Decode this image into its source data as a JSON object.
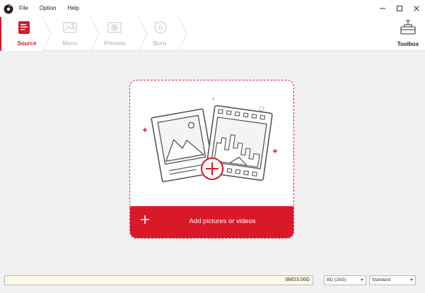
{
  "menu": {
    "items": [
      "File",
      "Option",
      "Help"
    ]
  },
  "steps": [
    {
      "label": "Source",
      "icon": "source-icon",
      "active": true
    },
    {
      "label": "Menu",
      "icon": "menu-icon",
      "active": false
    },
    {
      "label": "Preview",
      "icon": "preview-icon",
      "active": false
    },
    {
      "label": "Burn",
      "icon": "burn-icon",
      "active": false
    }
  ],
  "toolbox": {
    "label": "Toolbox",
    "icon": "toolbox-icon"
  },
  "dropzone": {
    "add_label": "Add pictures or videos"
  },
  "status": {
    "capacity_text": "0M/23.00G",
    "disc_type": "BD (25G)",
    "quality": "Standard"
  },
  "colors": {
    "accent": "#d9182a",
    "step_inactive": "#c8c8c8"
  }
}
